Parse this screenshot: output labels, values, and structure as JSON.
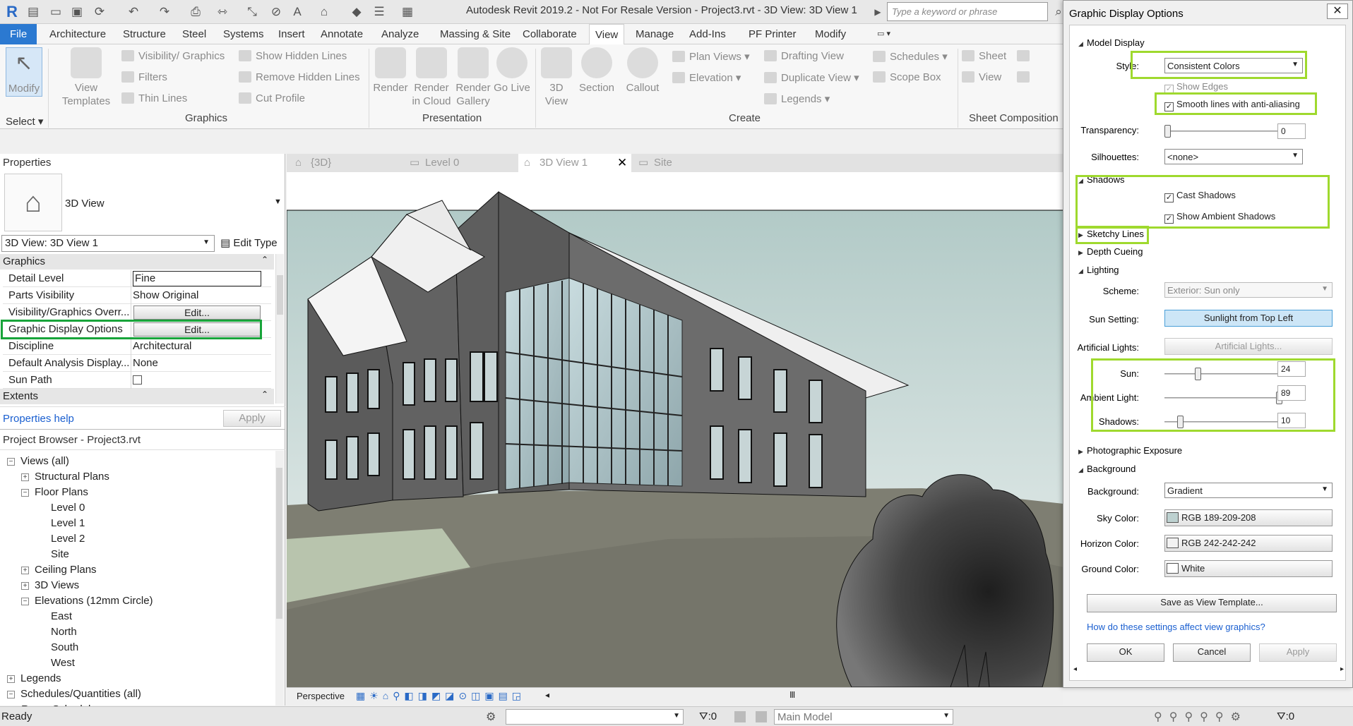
{
  "titlebar": {
    "title": "Autodesk Revit 2019.2 - Not For Resale Version - Project3.rvt - 3D View: 3D View 1",
    "search_placeholder": "Type a keyword or phrase"
  },
  "ribbon": {
    "tabs": [
      "File",
      "Architecture",
      "Structure",
      "Steel",
      "Systems",
      "Insert",
      "Annotate",
      "Analyze",
      "Massing & Site",
      "Collaborate",
      "View",
      "Manage",
      "Add-Ins",
      "PF Printer",
      "Modify"
    ],
    "active_tab": "View",
    "modify_label": "Modify",
    "select_label": "Select",
    "view_templates": "View Templates",
    "visibility_graphics": "Visibility/ Graphics",
    "filters": "Filters",
    "thin_lines": "Thin Lines",
    "show_hidden_lines": "Show Hidden Lines",
    "remove_hidden_lines": "Remove Hidden Lines",
    "cut_profile": "Cut Profile",
    "graphics_panel": "Graphics",
    "render": "Render",
    "render_cloud": "Render in Cloud",
    "render_gallery": "Render Gallery",
    "presentation_panel": "Presentation",
    "go_live": "Go Live",
    "view_3d": "3D View",
    "section": "Section",
    "callout": "Callout",
    "plan_views": "Plan Views",
    "elevation": "Elevation",
    "drafting_view": "Drafting View",
    "duplicate_view": "Duplicate View",
    "legends": "Legends",
    "schedules": "Schedules",
    "scope_box": "Scope Box",
    "create_panel": "Create",
    "sheet": "Sheet",
    "view": "View",
    "sheet_composition_panel": "Sheet Composition"
  },
  "properties": {
    "title": "Properties",
    "type_name": "3D View",
    "selector": "3D View: 3D View 1",
    "edit_type": "Edit Type",
    "group_graphics": "Graphics",
    "rows": [
      {
        "key": "Detail Level",
        "value": "Fine"
      },
      {
        "key": "Parts Visibility",
        "value": "Show Original"
      },
      {
        "key": "Visibility/Graphics Overr...",
        "value": "Edit..."
      },
      {
        "key": "Graphic Display Options",
        "value": "Edit..."
      },
      {
        "key": "Discipline",
        "value": "Architectural"
      },
      {
        "key": "Default Analysis Display...",
        "value": "None"
      },
      {
        "key": "Sun Path",
        "value": ""
      }
    ],
    "group_extents": "Extents",
    "help_link": "Properties help",
    "apply": "Apply"
  },
  "browser": {
    "title": "Project Browser - Project3.rvt",
    "items": [
      {
        "label": "Views (all)",
        "level": 0,
        "toggle": "-"
      },
      {
        "label": "Structural Plans",
        "level": 1,
        "toggle": "+"
      },
      {
        "label": "Floor Plans",
        "level": 1,
        "toggle": "-"
      },
      {
        "label": "Level 0",
        "level": 2,
        "toggle": ""
      },
      {
        "label": "Level 1",
        "level": 2,
        "toggle": ""
      },
      {
        "label": "Level 2",
        "level": 2,
        "toggle": ""
      },
      {
        "label": "Site",
        "level": 2,
        "toggle": ""
      },
      {
        "label": "Ceiling Plans",
        "level": 1,
        "toggle": "+"
      },
      {
        "label": "3D Views",
        "level": 1,
        "toggle": "+"
      },
      {
        "label": "Elevations (12mm Circle)",
        "level": 1,
        "toggle": "-"
      },
      {
        "label": "East",
        "level": 2,
        "toggle": ""
      },
      {
        "label": "North",
        "level": 2,
        "toggle": ""
      },
      {
        "label": "South",
        "level": 2,
        "toggle": ""
      },
      {
        "label": "West",
        "level": 2,
        "toggle": ""
      },
      {
        "label": "Legends",
        "level": 0,
        "toggle": "+"
      },
      {
        "label": "Schedules/Quantities (all)",
        "level": 0,
        "toggle": "-"
      },
      {
        "label": "Room Schedule",
        "level": 1,
        "toggle": ""
      }
    ]
  },
  "viewtabs": [
    {
      "label": "{3D}"
    },
    {
      "label": "Level 0"
    },
    {
      "label": "3D View 1"
    },
    {
      "label": "Site"
    }
  ],
  "viewbar": {
    "mode": "Perspective"
  },
  "statusbar": {
    "status": "Ready",
    "count_a": ":0",
    "workset": "Main Model",
    "count_b": ":0"
  },
  "dialog": {
    "title": "Graphic Display Options",
    "model_display": "Model Display",
    "style_label": "Style:",
    "style_value": "Consistent Colors",
    "show_edges": "Show Edges",
    "smooth_lines": "Smooth lines with anti-aliasing",
    "transparency_label": "Transparency:",
    "transparency_value": "0",
    "silhouettes_label": "Silhouettes:",
    "silhouettes_value": "<none>",
    "shadows": "Shadows",
    "cast_shadows": "Cast Shadows",
    "ambient_shadows": "Show Ambient Shadows",
    "sketchy_lines": "Sketchy Lines",
    "depth_cueing": "Depth Cueing",
    "lighting": "Lighting",
    "scheme_label": "Scheme:",
    "scheme_value": "Exterior: Sun only",
    "sun_setting_label": "Sun Setting:",
    "sun_setting_value": "Sunlight from Top Left",
    "artificial_label": "Artificial Lights:",
    "artificial_value": "Artificial Lights...",
    "sun_label": "Sun:",
    "sun_value": "24",
    "ambient_label": "Ambient Light:",
    "ambient_value": "89",
    "shadows_label": "Shadows:",
    "shadows_value": "10",
    "photographic_exposure": "Photographic Exposure",
    "background": "Background",
    "background_label": "Background:",
    "background_value": "Gradient",
    "sky_label": "Sky Color:",
    "sky_value": "RGB 189-209-208",
    "sky_color": "#bdd1d0",
    "horizon_label": "Horizon Color:",
    "horizon_value": "RGB 242-242-242",
    "horizon_color": "#f2f2f2",
    "ground_label": "Ground Color:",
    "ground_value": "White",
    "ground_color": "#ffffff",
    "save_template": "Save as View Template...",
    "help_link": "How do these settings affect view graphics?",
    "ok": "OK",
    "cancel": "Cancel",
    "apply": "Apply"
  }
}
